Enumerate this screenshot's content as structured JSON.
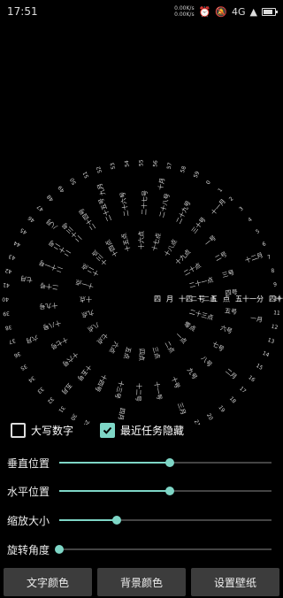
{
  "status_bar": {
    "time": "17:51",
    "net_up": "0.00K/s",
    "net_down": "0.00K/s",
    "network": "4G",
    "icons": [
      "alarm-icon",
      "mute-icon",
      "wifi-icon",
      "signal-icon",
      "battery-icon"
    ]
  },
  "clock": {
    "time_readout": [
      "四",
      "月",
      "十四",
      "号",
      "五",
      "点",
      "五十一分",
      "四十四秒"
    ],
    "rings": {
      "month": [
        "一",
        "二",
        "三",
        "四",
        "五",
        "六",
        "七",
        "八",
        "九",
        "十",
        "十一",
        "十二"
      ],
      "day": [
        "一",
        "二",
        "三",
        "四",
        "五",
        "六",
        "七",
        "八",
        "九",
        "十",
        "十一",
        "十二",
        "十三",
        "十四",
        "十五",
        "十六",
        "十七",
        "十八",
        "十九",
        "二十",
        "二十一",
        "二十二",
        "二十三",
        "二十四",
        "二十五",
        "二十六",
        "二十七",
        "二十八",
        "二十九",
        "三十"
      ],
      "hour": [
        "零",
        "一",
        "二",
        "三",
        "四",
        "五",
        "六",
        "七",
        "八",
        "九",
        "十",
        "十一",
        "十二",
        "十三",
        "十四",
        "十五",
        "十六",
        "十七",
        "十八",
        "十九",
        "二十",
        "二十一",
        "二十二",
        "二十三"
      ]
    }
  },
  "options": {
    "uppercase_numbers": {
      "label": "大写数字",
      "checked": false
    },
    "hide_recent": {
      "label": "最近任务隐藏",
      "checked": true
    }
  },
  "sliders": [
    {
      "label": "垂直位置",
      "value": 0.52
    },
    {
      "label": "水平位置",
      "value": 0.52
    },
    {
      "label": "缩放大小",
      "value": 0.27
    },
    {
      "label": "旋转角度",
      "value": 0.0
    }
  ],
  "buttons": {
    "text_color": "文字颜色",
    "bg_color": "背景颜色",
    "set_wallpaper": "设置壁纸"
  },
  "colors": {
    "accent": "#7ed6c6",
    "background": "#000000",
    "button": "#3c3c3c"
  }
}
